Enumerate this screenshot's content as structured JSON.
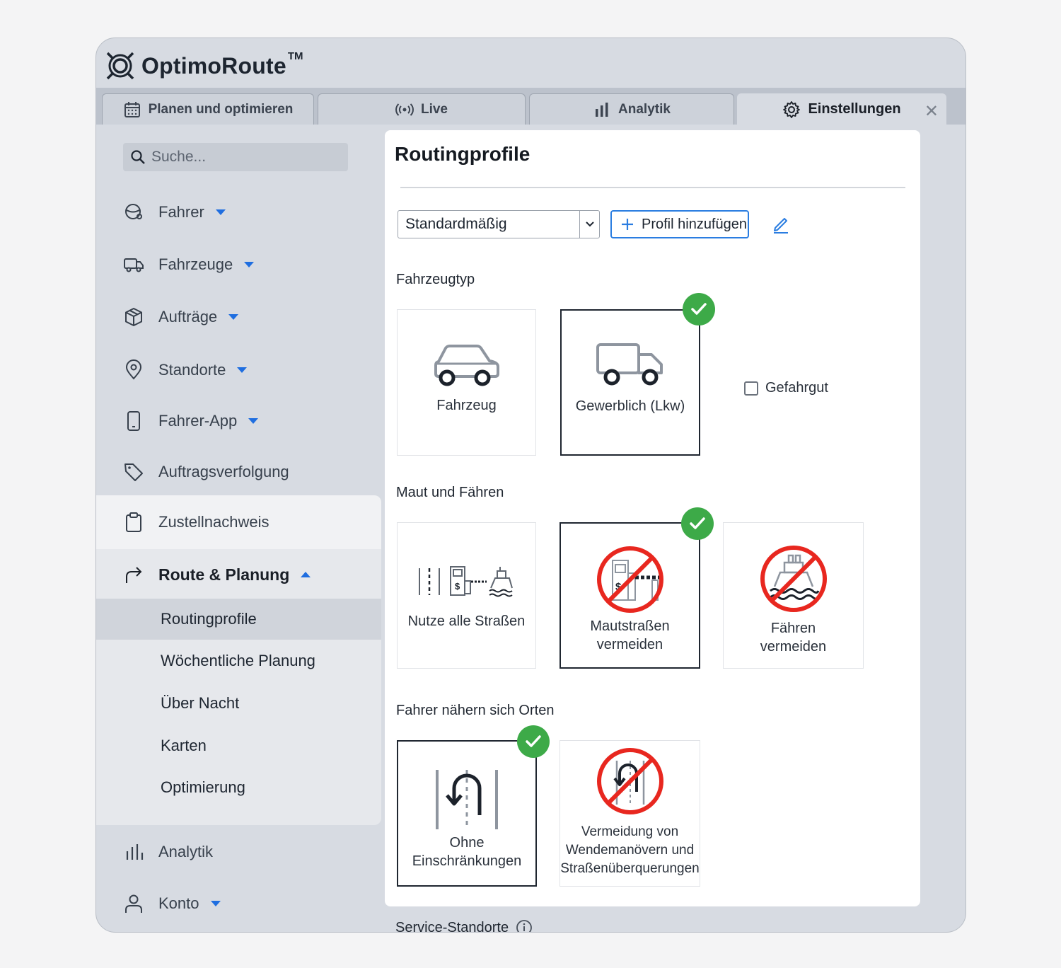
{
  "app": {
    "name": "OptimoRoute",
    "trademark": "TM"
  },
  "tabs": [
    {
      "label": "Planen und optimieren",
      "icon": "calendar-icon"
    },
    {
      "label": "Live",
      "icon": "broadcast-icon"
    },
    {
      "label": "Analytik",
      "icon": "bar-chart-icon"
    },
    {
      "label": "Einstellungen",
      "icon": "gear-icon",
      "close": "✕"
    }
  ],
  "sidebar": {
    "search_placeholder": "Suche...",
    "items": [
      {
        "label": "Fahrer",
        "icon": "driver-icon"
      },
      {
        "label": "Fahrzeuge",
        "icon": "truck-icon"
      },
      {
        "label": "Aufträge",
        "icon": "box-icon"
      },
      {
        "label": "Standorte",
        "icon": "pin-icon"
      },
      {
        "label": "Fahrer-App",
        "icon": "phone-icon"
      },
      {
        "label": "Auftragsverfolgung",
        "icon": "tag-icon"
      },
      {
        "label": "Zustellnachweis",
        "icon": "clipboard-icon"
      },
      {
        "label": "Route & Planung",
        "icon": "route-arrow-icon"
      },
      {
        "label": "Analytik",
        "icon": "bar-chart-icon"
      },
      {
        "label": "Konto",
        "icon": "user-icon"
      }
    ],
    "sub_items": [
      "Routingprofile",
      "Wöchentliche Planung",
      "Über Nacht",
      "Karten",
      "Optimierung"
    ]
  },
  "content": {
    "title": "Routingprofile",
    "profile_select": "Standardmäßig",
    "add_profile": "Profil hinzufügen",
    "sections": {
      "vehicle_type": {
        "label": "Fahrzeugtyp",
        "cards": [
          "Fahrzeug",
          "Gewerblich (Lkw)"
        ],
        "selected": 1,
        "hazmat_label": "Gefahrgut"
      },
      "tolls": {
        "label": "Maut und Fähren",
        "cards": [
          [
            "Nutze alle Straßen"
          ],
          [
            "Mautstraßen",
            "vermeiden"
          ],
          [
            "Fähren",
            "vermeiden"
          ]
        ],
        "selected": 1
      },
      "approach": {
        "label": "Fahrer nähern sich Orten",
        "cards": [
          [
            "Ohne",
            "Einschränkungen"
          ],
          [
            "Vermeidung von",
            "Wendemanövern und",
            "Straßenüberquerungen"
          ]
        ],
        "selected": 0
      }
    },
    "service_label": "Service-Standorte"
  },
  "colors": {
    "accent": "#1f6ee0",
    "check": "#3daa48",
    "forbidden": "#e8271f"
  }
}
